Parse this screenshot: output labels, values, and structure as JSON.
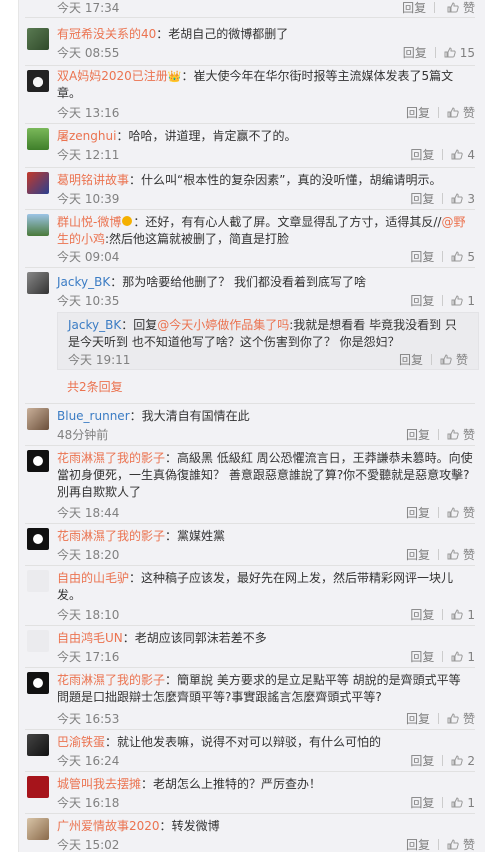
{
  "actions": {
    "reply_label": "回复",
    "like_label": "赞"
  },
  "top_partial": {
    "time": "今天 17:34"
  },
  "comments": [
    {
      "user": "有冠希没关系的40",
      "sep": "：",
      "text": "老胡自己的微博都删了",
      "time": "今天 08:55",
      "likes": "15"
    },
    {
      "user": "双A妈妈2020已注册",
      "sep": "：",
      "text": "崔大使今年在华尔街时报等主流媒体发表了5篇文章。",
      "time": "今天 13:16",
      "likes": "赞"
    },
    {
      "user": "屠zenghui",
      "sep": "：",
      "text": "哈哈，讲道理，肯定赢不了的。",
      "time": "今天 12:11",
      "likes": "4"
    },
    {
      "user": "葛明铭讲故事",
      "sep": "：",
      "text": "什么叫“根本性的复杂因素”，真的没听懂，胡编请明示。",
      "time": "今天 10:39",
      "likes": "3"
    },
    {
      "user": "群山悦-微博",
      "sep": "：",
      "text_a": "还好，有有心人截了屏。文章显得乱了方寸，适得其反//",
      "mention": "@野生的小鸡",
      "text_b": ":然后他这篇就被删了，简直是打脸",
      "time": "今天 09:04",
      "likes": "5"
    },
    {
      "user": "Jacky_BK",
      "sep": "：",
      "text": "那为啥要给他删了？ 我们都没看着到底写了啥",
      "time": "今天 10:35",
      "likes": "1"
    },
    {
      "user": "Blue_runner",
      "sep": "：",
      "text": "我大清自有国情在此",
      "time": "48分钟前",
      "likes": "赞"
    },
    {
      "user": "花雨淋濕了我的影子",
      "sep": "：",
      "text": "高級黑  低級紅  周公恐懼流言日，王莽謙恭未篡時。向使當初身便死，一生真偽復誰知？  善意跟惡意誰說了算?你不愛聽就是惡意攻擊?別再自欺欺人了",
      "time": "今天 18:44",
      "likes": "赞"
    },
    {
      "user": "花雨淋濕了我的影子",
      "sep": "：",
      "text": "黨媒姓黨",
      "time": "今天 18:20",
      "likes": "赞"
    },
    {
      "user": "自由的山毛驴",
      "sep": "：",
      "text": "这种稿子应该发，最好先在网上发，然后带精彩网评一块儿发。",
      "time": "今天 18:10",
      "likes": "1"
    },
    {
      "user": "自由鸿毛UN",
      "sep": "：",
      "text": "老胡应该同郭沫若差不多",
      "time": "今天 17:16",
      "likes": "1"
    },
    {
      "user": "花雨淋濕了我的影子",
      "sep": "：",
      "text": "簡單說  美方要求的是立足點平等 胡說的是齊頭式平等  問題是口拙跟辯士怎麼齊頭平等?事實跟謠言怎麼齊頭式平等?",
      "time": "今天 16:53",
      "likes": "赞"
    },
    {
      "user": "巴渝铁蛋",
      "sep": "：",
      "text": "就让他发表嘛，说得不对可以辩驳，有什么可怕的",
      "time": "今天 16:24",
      "likes": "2"
    },
    {
      "user": "城管叫我去摆摊",
      "sep": "：",
      "text": "老胡怎么上推特的？严厉查办！",
      "time": "今天 16:18",
      "likes": "1"
    },
    {
      "user": "广州爱情故事2020",
      "sep": "：",
      "text": "转发微博",
      "time": "今天 15:02",
      "likes": "赞"
    }
  ],
  "sub_reply": {
    "user": "Jacky_BK",
    "text_a": "：回复",
    "mention": "@今天小婷做作品集了吗",
    "text_b": ":我就是想看看 毕竟我没看到 只是今天听到 也不知道他写了啥？这个伤害到你了？ 你是怨妇？",
    "time": "今天 19:11",
    "likes": "赞"
  },
  "more_replies": "共2条回复",
  "colors": {
    "username": "#eb7350",
    "meta": "#808080",
    "panel_bg": "#f2f2f5"
  }
}
